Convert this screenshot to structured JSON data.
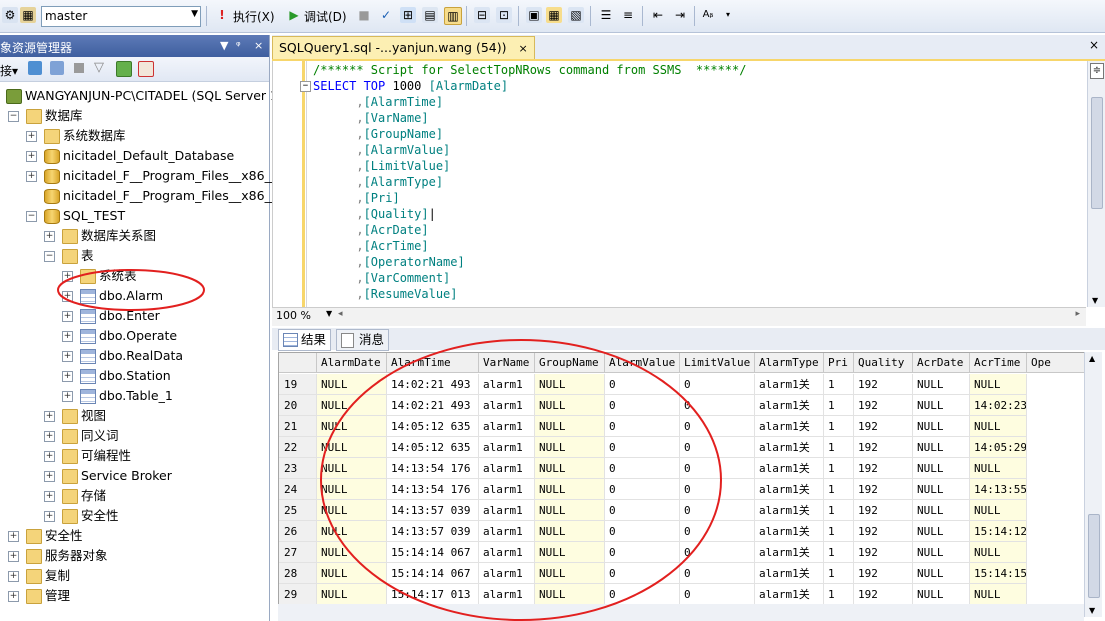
{
  "toolbar": {
    "database": "master",
    "execute_label": "执行(X)",
    "debug_label": "调试(D)"
  },
  "object_explorer": {
    "title": "象资源管理器",
    "connect_label": "接▾",
    "tree": [
      {
        "label": "WANGYANJUN-PC\\CITADEL (SQL Server 1",
        "icon": "server-icon",
        "expander": "-"
      },
      {
        "label": "数据库",
        "icon": "folder-icon",
        "expander": "-"
      },
      {
        "label": "系统数据库",
        "icon": "folder-icon",
        "expander": "+"
      },
      {
        "label": "nicitadel_Default_Database",
        "icon": "database-icon",
        "expander": "+"
      },
      {
        "label": "nicitadel_F__Program_Files__x86__Na",
        "icon": "database-icon",
        "expander": "+"
      },
      {
        "label": "nicitadel_F__Program_Files__x86__Na",
        "icon": "database-icon",
        "expander": ""
      },
      {
        "label": "SQL_TEST",
        "icon": "database-icon",
        "expander": "-"
      },
      {
        "label": "数据库关系图",
        "icon": "folder-icon",
        "expander": "+"
      },
      {
        "label": "表",
        "icon": "folder-icon",
        "expander": "-"
      },
      {
        "label": "系统表",
        "icon": "folder-icon",
        "expander": "+"
      },
      {
        "label": "dbo.Alarm",
        "icon": "table-icon",
        "expander": "+"
      },
      {
        "label": "dbo.Enter",
        "icon": "table-icon",
        "expander": "+"
      },
      {
        "label": "dbo.Operate",
        "icon": "table-icon",
        "expander": "+"
      },
      {
        "label": "dbo.RealData",
        "icon": "table-icon",
        "expander": "+"
      },
      {
        "label": "dbo.Station",
        "icon": "table-icon",
        "expander": "+"
      },
      {
        "label": "dbo.Table_1",
        "icon": "table-icon",
        "expander": "+"
      },
      {
        "label": "视图",
        "icon": "folder-icon",
        "expander": "+"
      },
      {
        "label": "同义词",
        "icon": "folder-icon",
        "expander": "+"
      },
      {
        "label": "可编程性",
        "icon": "folder-icon",
        "expander": "+"
      },
      {
        "label": "Service Broker",
        "icon": "folder-icon",
        "expander": "+"
      },
      {
        "label": "存储",
        "icon": "folder-icon",
        "expander": "+"
      },
      {
        "label": "安全性",
        "icon": "folder-icon",
        "expander": "+"
      },
      {
        "label": "安全性",
        "icon": "folder-icon",
        "expander": "+"
      },
      {
        "label": "服务器对象",
        "icon": "folder-icon",
        "expander": "+"
      },
      {
        "label": "复制",
        "icon": "folder-icon",
        "expander": "+"
      },
      {
        "label": "管理",
        "icon": "folder-icon",
        "expander": "+"
      }
    ]
  },
  "editor": {
    "tab_title": "SQLQuery1.sql -...yanjun.wang (54))",
    "tab_close": "×",
    "zoom": "100 %",
    "comment": "/****** Script for SelectTopNRows command from SSMS  ******/",
    "select_kw": "SELECT TOP",
    "top_n": "1000",
    "columns": [
      "[AlarmDate]",
      "[AlarmTime]",
      "[VarName]",
      "[GroupName]",
      "[AlarmValue]",
      "[LimitValue]",
      "[AlarmType]",
      "[Pri]",
      "[Quality]",
      "[AcrDate]",
      "[AcrTime]",
      "[OperatorName]",
      "[VarComment]",
      "[ResumeValue]"
    ]
  },
  "results": {
    "tab_results": "结果",
    "tab_messages": "消息",
    "headers": [
      "AlarmDate",
      "AlarmTime",
      "VarName",
      "GroupName",
      "AlarmValue",
      "LimitValue",
      "AlarmType",
      "Pri",
      "Quality",
      "AcrDate",
      "AcrTime",
      "Ope"
    ],
    "rows": [
      [
        "19",
        "NULL",
        "14:02:21  493",
        "alarm1",
        "NULL",
        "0",
        "0",
        "alarm1关",
        "1",
        "192",
        "NULL",
        "NULL"
      ],
      [
        "20",
        "NULL",
        "14:02:21  493",
        "alarm1",
        "NULL",
        "0",
        "0",
        "alarm1关",
        "1",
        "192",
        "NULL",
        "14:02:23  793"
      ],
      [
        "21",
        "NULL",
        "14:05:12  635",
        "alarm1",
        "NULL",
        "0",
        "0",
        "alarm1关",
        "1",
        "192",
        "NULL",
        "NULL"
      ],
      [
        "22",
        "NULL",
        "14:05:12  635",
        "alarm1",
        "NULL",
        "0",
        "0",
        "alarm1关",
        "1",
        "192",
        "NULL",
        "14:05:29  156"
      ],
      [
        "23",
        "NULL",
        "14:13:54  176",
        "alarm1",
        "NULL",
        "0",
        "0",
        "alarm1关",
        "1",
        "192",
        "NULL",
        "NULL"
      ],
      [
        "24",
        "NULL",
        "14:13:54  176",
        "alarm1",
        "NULL",
        "0",
        "0",
        "alarm1关",
        "1",
        "192",
        "NULL",
        "14:13:55  754"
      ],
      [
        "25",
        "NULL",
        "14:13:57  039",
        "alarm1",
        "NULL",
        "0",
        "0",
        "alarm1关",
        "1",
        "192",
        "NULL",
        "NULL"
      ],
      [
        "26",
        "NULL",
        "14:13:57  039",
        "alarm1",
        "NULL",
        "0",
        "0",
        "alarm1关",
        "1",
        "192",
        "NULL",
        "15:14:12  850"
      ],
      [
        "27",
        "NULL",
        "15:14:14  067",
        "alarm1",
        "NULL",
        "0",
        "0",
        "alarm1关",
        "1",
        "192",
        "NULL",
        "NULL"
      ],
      [
        "28",
        "NULL",
        "15:14:14  067",
        "alarm1",
        "NULL",
        "0",
        "0",
        "alarm1关",
        "1",
        "192",
        "NULL",
        "15:14:15  751"
      ],
      [
        "29",
        "NULL",
        "15:14:17  013",
        "alarm1",
        "NULL",
        "0",
        "0",
        "alarm1关",
        "1",
        "192",
        "NULL",
        "NULL"
      ]
    ]
  },
  "colors": {
    "annotation_red": "#e2201f",
    "grid_highlight": "#fefde0",
    "tab_active": "#fcefb3"
  }
}
